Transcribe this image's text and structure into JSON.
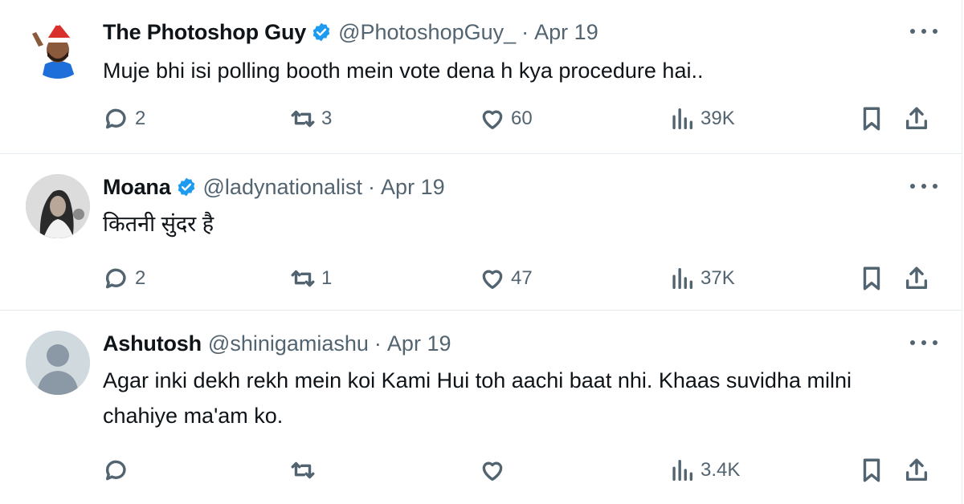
{
  "tweets": [
    {
      "name": "The Photoshop Guy",
      "handle": "@PhotoshopGuy_",
      "separator": "·",
      "date": "Apr 19",
      "verified": true,
      "text": "Muje bhi isi polling booth mein vote dena h kya procedure hai..",
      "replies": "2",
      "retweets": "3",
      "likes": "60",
      "views": "39K"
    },
    {
      "name": "Moana",
      "handle": "@ladynationalist",
      "separator": "·",
      "date": "Apr 19",
      "verified": true,
      "text": "कितनी सुंदर है",
      "replies": "2",
      "retweets": "1",
      "likes": "47",
      "views": "37K"
    },
    {
      "name": "Ashutosh",
      "handle": "@shinigamiashu",
      "separator": "·",
      "date": "Apr 19",
      "verified": false,
      "text": "Agar inki dekh rekh mein koi Kami Hui toh aachi baat nhi. Khaas suvidha milni chahiye ma'am ko.",
      "replies": "",
      "retweets": "",
      "likes": "",
      "views": "3.4K"
    }
  ],
  "colors": {
    "text": "#0f1419",
    "secondary": "#536471",
    "verified": "#1d9bf0",
    "divider": "#e6ecf0"
  },
  "icons": [
    "reply-icon",
    "retweet-icon",
    "like-icon",
    "views-icon",
    "bookmark-icon",
    "share-icon",
    "more-icon",
    "verified-icon"
  ]
}
